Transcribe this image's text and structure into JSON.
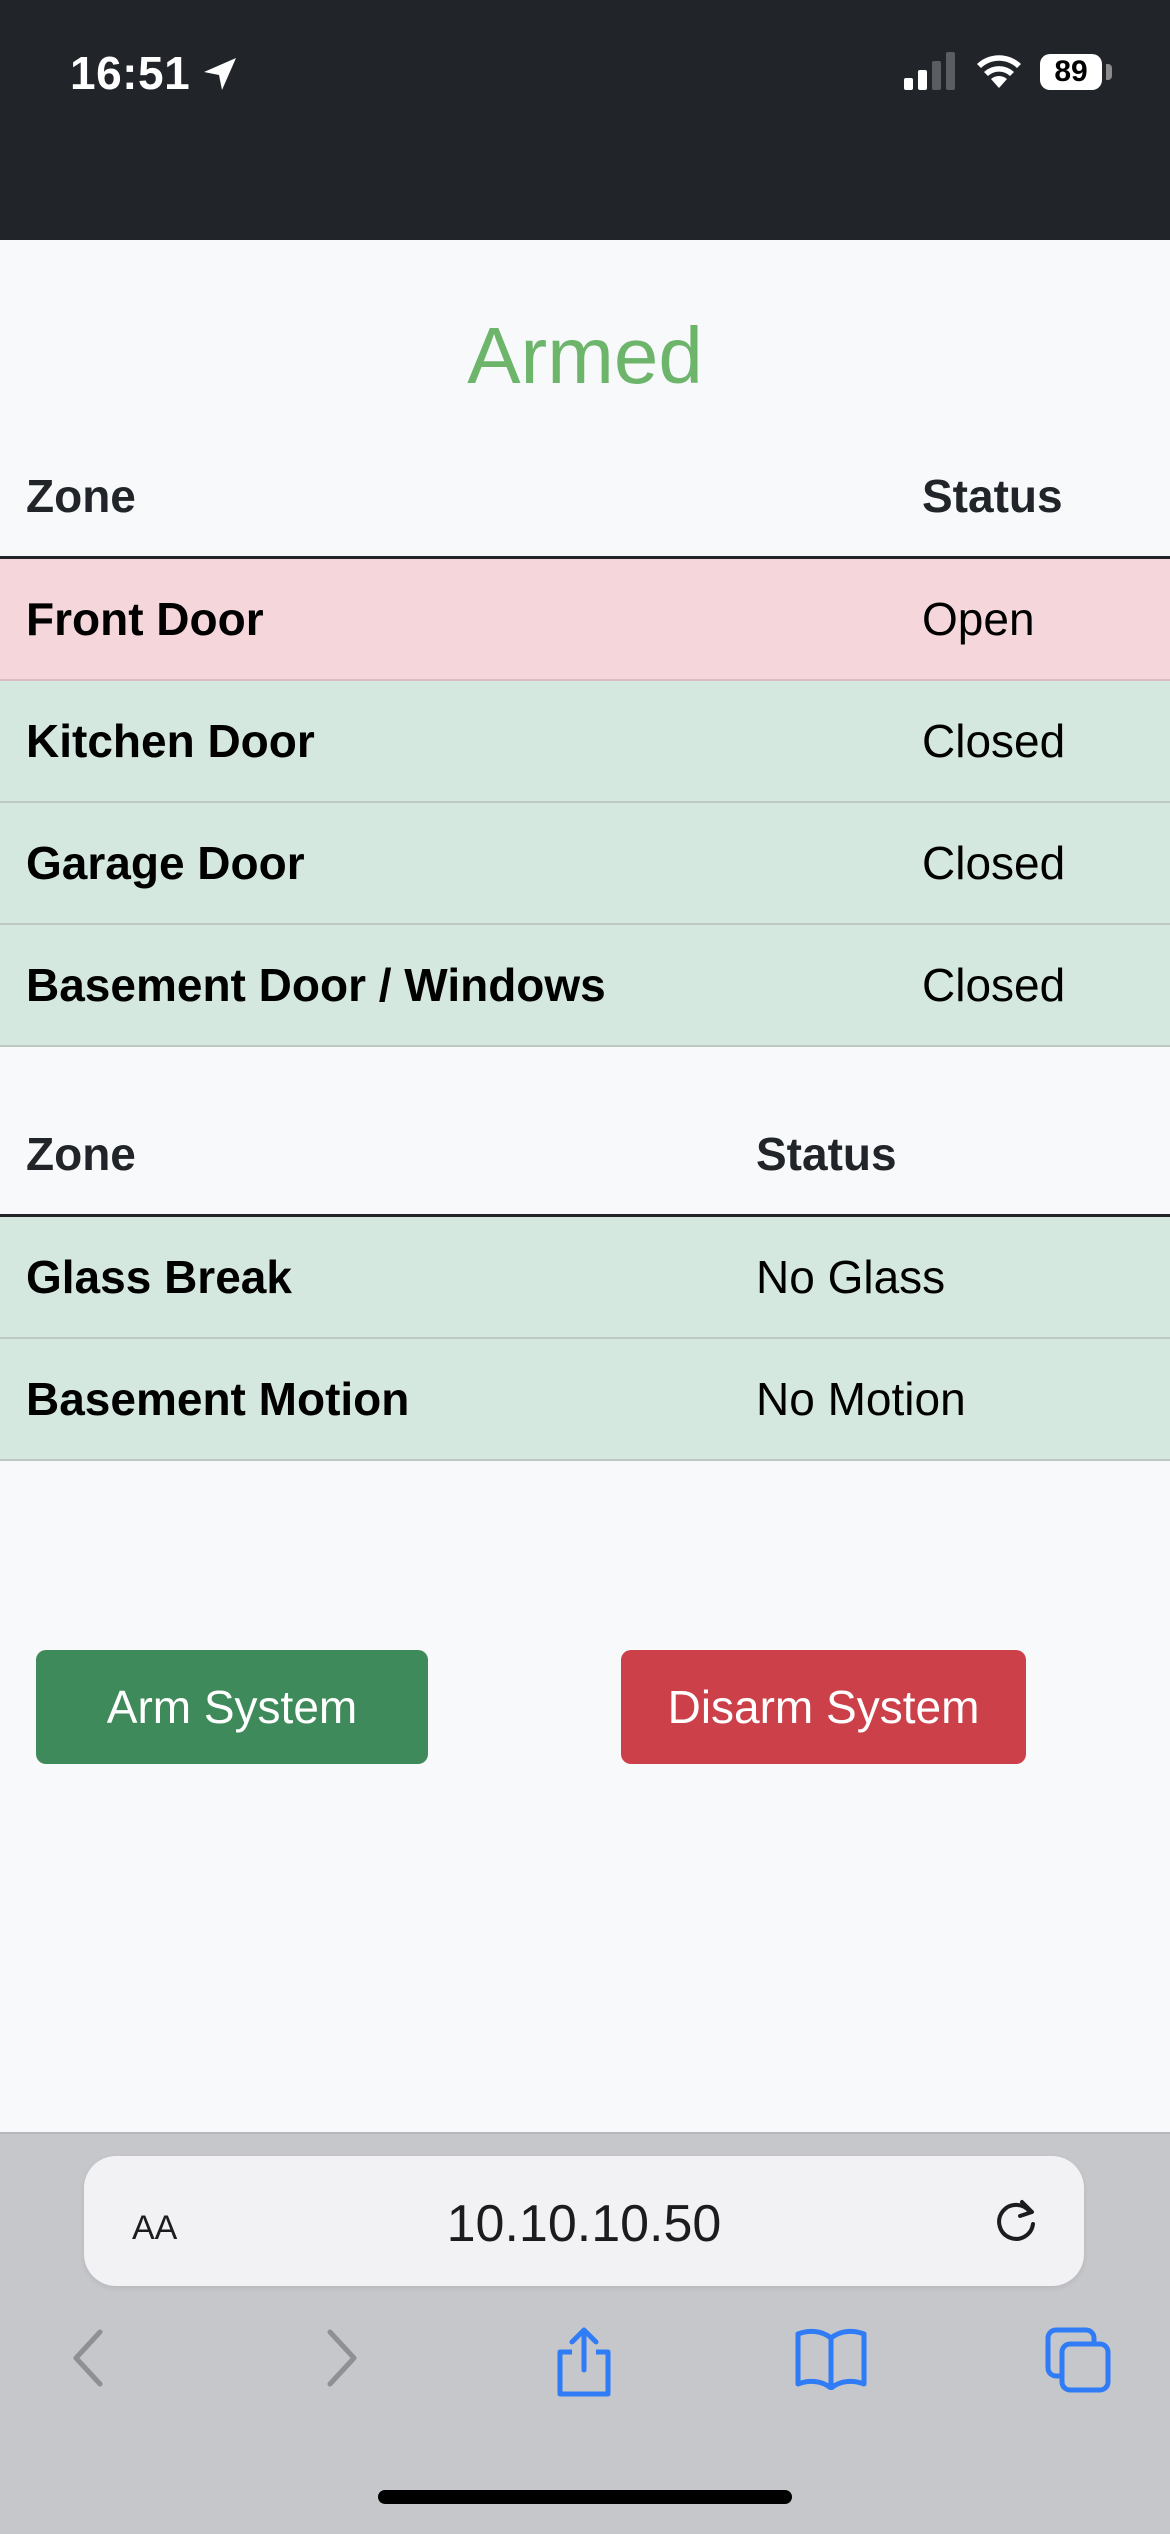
{
  "status_bar": {
    "time": "16:51",
    "battery": "89",
    "icons": [
      "location-arrow-icon",
      "cellular-signal-icon",
      "wifi-icon",
      "battery-icon"
    ]
  },
  "page": {
    "title": "Armed",
    "title_color": "#6cb56b"
  },
  "door_table": {
    "headers": {
      "zone": "Zone",
      "status": "Status"
    },
    "rows": [
      {
        "zone": "Front Door",
        "status": "Open",
        "state": "alert"
      },
      {
        "zone": "Kitchen Door",
        "status": "Closed",
        "state": "ok"
      },
      {
        "zone": "Garage Door",
        "status": "Closed",
        "state": "ok"
      },
      {
        "zone": "Basement Door / Windows",
        "status": "Closed",
        "state": "ok"
      }
    ]
  },
  "sensor_table": {
    "headers": {
      "zone": "Zone",
      "status": "Status"
    },
    "rows": [
      {
        "zone": "Glass Break",
        "status": "No Glass",
        "state": "ok"
      },
      {
        "zone": "Basement Motion",
        "status": "No Motion",
        "state": "ok"
      }
    ]
  },
  "actions": {
    "arm_label": "Arm System",
    "disarm_label": "Disarm System",
    "arm_color": "#3f8a5a",
    "disarm_color": "#cc4049"
  },
  "browser": {
    "text_size_label": "AA",
    "url": "10.10.10.50",
    "toolbar": [
      "back-icon",
      "forward-icon",
      "share-icon",
      "bookmarks-icon",
      "tabs-icon"
    ]
  }
}
